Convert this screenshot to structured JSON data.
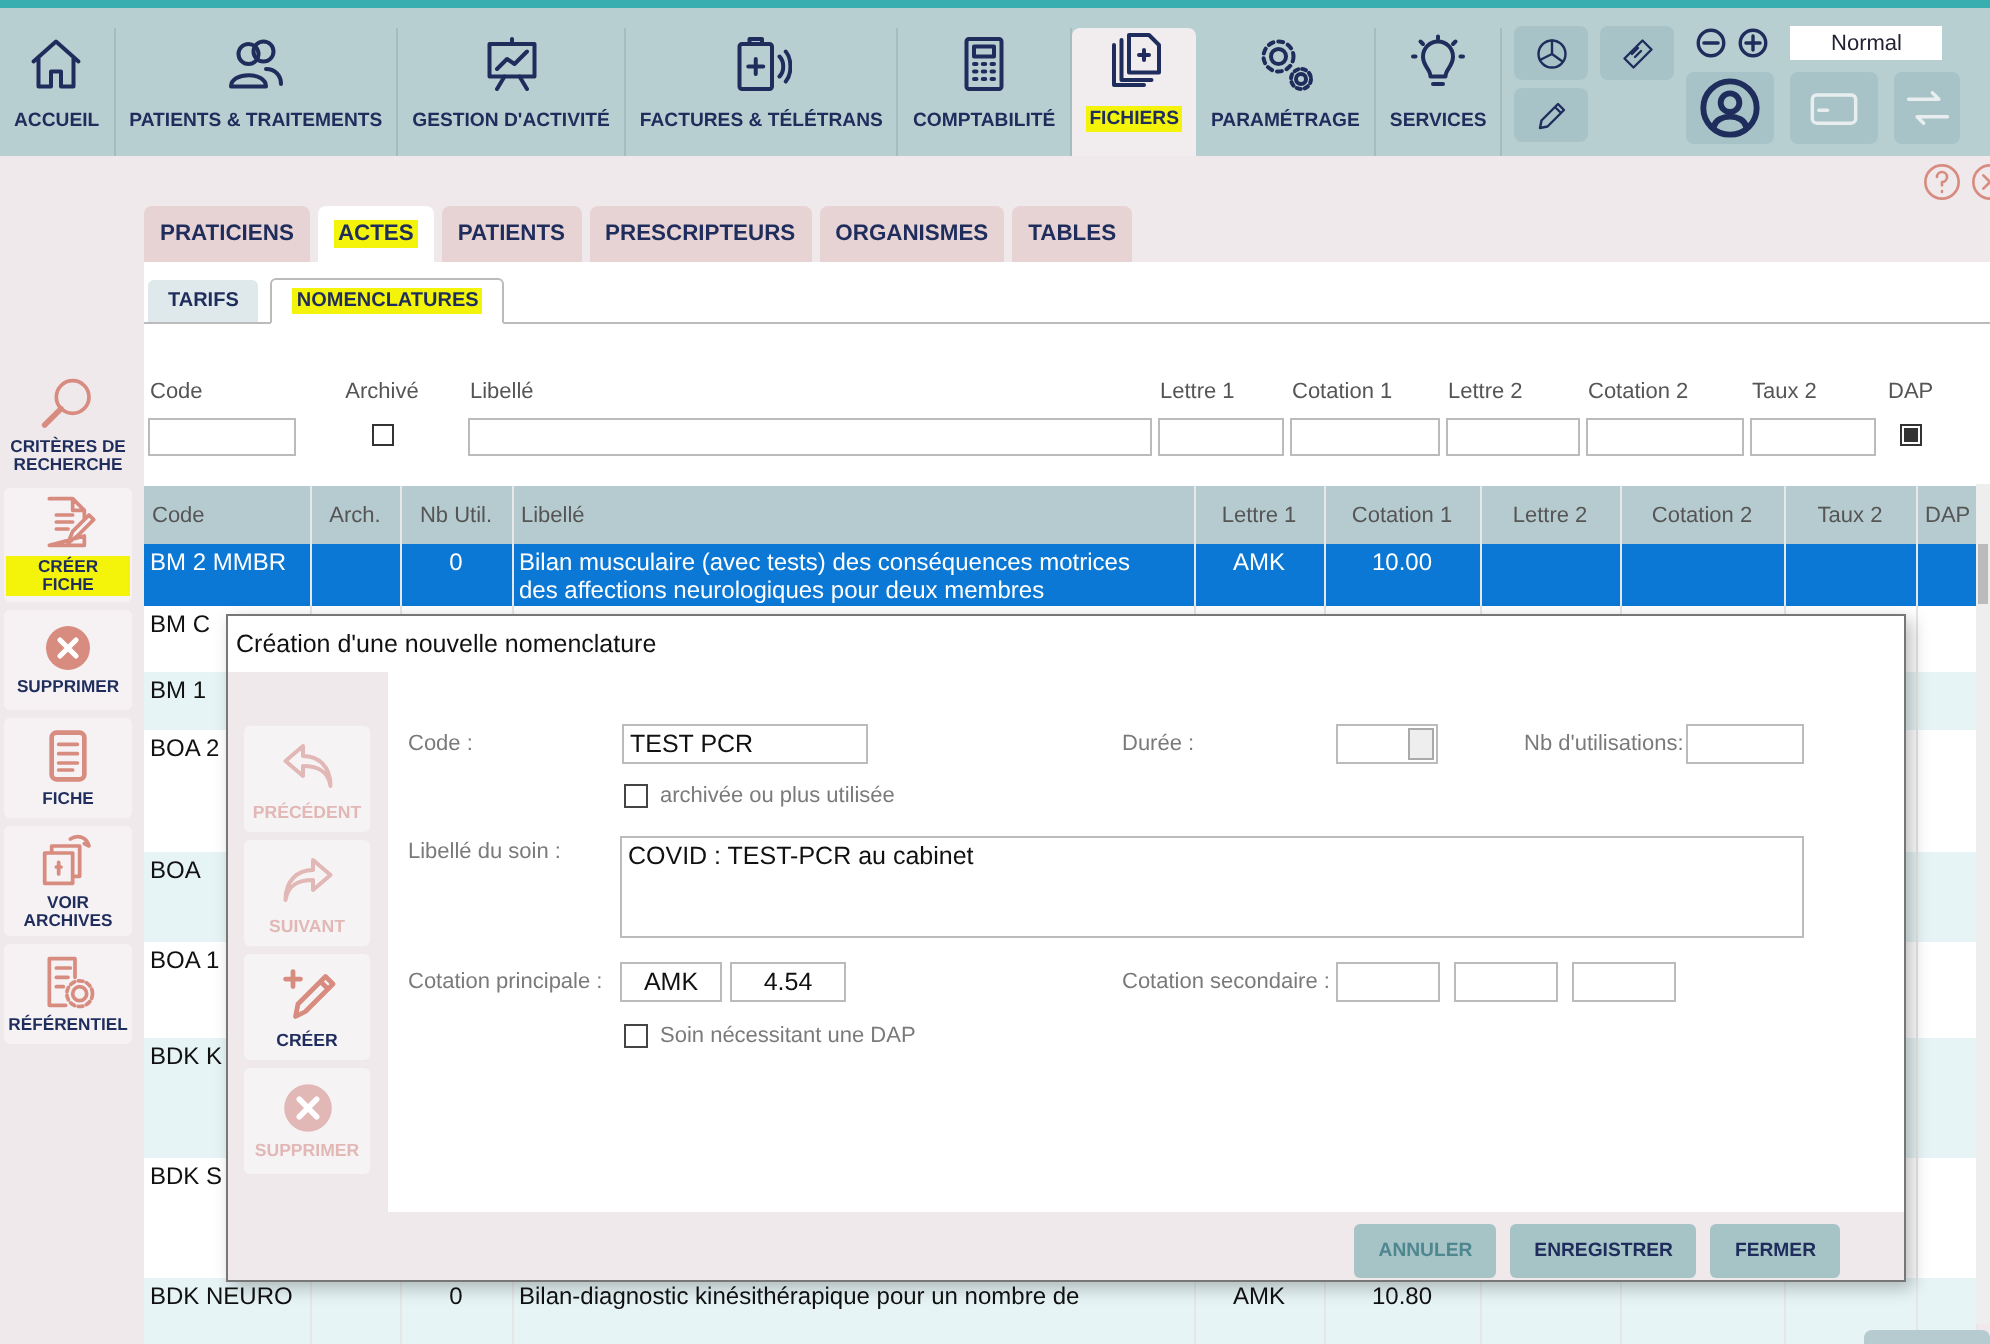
{
  "nav": {
    "items": [
      {
        "label": "ACCUEIL",
        "selected": false,
        "highlighted": false
      },
      {
        "label": "PATIENTS & TRAITEMENTS",
        "selected": false,
        "highlighted": false
      },
      {
        "label": "GESTION D'ACTIVITÉ",
        "selected": false,
        "highlighted": false
      },
      {
        "label": "FACTURES & TÉLÉTRANS",
        "selected": false,
        "highlighted": false
      },
      {
        "label": "COMPTABILITÉ",
        "selected": false,
        "highlighted": false
      },
      {
        "label": "FICHIERS",
        "selected": true,
        "highlighted": true
      },
      {
        "label": "PARAMÉTRAGE",
        "selected": false,
        "highlighted": false
      },
      {
        "label": "SERVICES",
        "selected": false,
        "highlighted": false
      }
    ],
    "zoom_level": "Normal"
  },
  "sidebar": {
    "items": [
      {
        "label": "CRITÈRES DE RECHERCHE",
        "highlighted": false
      },
      {
        "label": "CRÉER FICHE",
        "highlighted": true
      },
      {
        "label": "SUPPRIMER",
        "highlighted": false
      },
      {
        "label": "FICHE",
        "highlighted": false
      },
      {
        "label": "VOIR ARCHIVES",
        "highlighted": false
      },
      {
        "label": "RÉFÉRENTIEL",
        "highlighted": false
      }
    ]
  },
  "tabs": [
    {
      "label": "PRATICIENS",
      "selected": false,
      "highlighted": false
    },
    {
      "label": "ACTES",
      "selected": true,
      "highlighted": true
    },
    {
      "label": "PATIENTS",
      "selected": false,
      "highlighted": false
    },
    {
      "label": "PRESCRIPTEURS",
      "selected": false,
      "highlighted": false
    },
    {
      "label": "ORGANISMES",
      "selected": false,
      "highlighted": false
    },
    {
      "label": "TABLES",
      "selected": false,
      "highlighted": false
    }
  ],
  "subtabs": [
    {
      "label": "TARIFS",
      "selected": false,
      "highlighted": false
    },
    {
      "label": "NOMENCLATURES",
      "selected": true,
      "highlighted": true
    }
  ],
  "filters": [
    {
      "kind": "text",
      "label": "Code"
    },
    {
      "kind": "checkbox",
      "label": "Archivé",
      "checked": false
    },
    {
      "kind": "text",
      "label": "Libellé"
    },
    {
      "kind": "text",
      "label": "Lettre 1"
    },
    {
      "kind": "text",
      "label": "Cotation 1"
    },
    {
      "kind": "text",
      "label": "Lettre 2"
    },
    {
      "kind": "text",
      "label": "Cotation 2"
    },
    {
      "kind": "text",
      "label": "Taux 2"
    },
    {
      "kind": "checkbox",
      "label": "DAP",
      "checked": true
    }
  ],
  "table": {
    "columns": [
      {
        "label": "Code"
      },
      {
        "label": "Arch."
      },
      {
        "label": "Nb Util."
      },
      {
        "label": "Libellé"
      },
      {
        "label": "Lettre 1"
      },
      {
        "label": "Cotation 1"
      },
      {
        "label": "Lettre 2"
      },
      {
        "label": "Cotation 2"
      },
      {
        "label": "Taux 2"
      },
      {
        "label": "DAP"
      }
    ],
    "rows": [
      {
        "selected": true,
        "cells": {
          "code": "BM 2 MMBR",
          "nb_util": "0",
          "libelle": "Bilan musculaire (avec tests) des conséquences motrices des affections neurologiques pour deux membres",
          "lettre_1": "AMK",
          "cotation_1": "10.00"
        }
      },
      {
        "selected": false,
        "cells": {
          "code": "BM C"
        }
      },
      {
        "selected": false,
        "cells": {
          "code": "BM 1"
        }
      },
      {
        "selected": false,
        "cells": {
          "code": "BOA 2"
        }
      },
      {
        "selected": false,
        "cells": {
          "code": "BOA"
        }
      },
      {
        "selected": false,
        "cells": {
          "code": "BOA 1"
        }
      },
      {
        "selected": false,
        "cells": {
          "code": "BDK K"
        }
      },
      {
        "selected": false,
        "cells": {
          "code": "BDK S"
        }
      },
      {
        "selected": false,
        "cells": {
          "code": "BDK NEURO",
          "nb_util": "0",
          "libelle": "Bilan-diagnostic kinésithérapique pour un nombre de",
          "lettre_1": "AMK",
          "cotation_1": "10.80"
        }
      }
    ]
  },
  "dialog": {
    "title": "Création d'une nouvelle nomenclature",
    "side_buttons": [
      {
        "label": "PRÉCÉDENT",
        "disabled": true
      },
      {
        "label": "SUIVANT",
        "disabled": true
      },
      {
        "label": "CRÉER",
        "disabled": false
      },
      {
        "label": "SUPPRIMER",
        "disabled": true
      }
    ],
    "code": {
      "label": "Code :",
      "value": "TEST PCR"
    },
    "duree": {
      "label": "Durée :"
    },
    "nb_utilisations": {
      "label": "Nb d'utilisations:"
    },
    "archived": {
      "label": "archivée ou plus utilisée",
      "checked": false
    },
    "libelle": {
      "label": "Libellé du soin :",
      "value": "COVID : TEST-PCR au cabinet"
    },
    "cotation_principale": {
      "label": "Cotation principale :",
      "lettre": "AMK",
      "valeur": "4.54"
    },
    "cotation_secondaire": {
      "label": "Cotation secondaire :"
    },
    "dap": {
      "label": "Soin nécessitant une DAP",
      "checked": false
    },
    "footer_buttons": [
      {
        "label": "ANNULER",
        "disabled": true
      },
      {
        "label": "ENREGISTRER",
        "disabled": false
      },
      {
        "label": "FERMER",
        "disabled": false
      }
    ]
  }
}
